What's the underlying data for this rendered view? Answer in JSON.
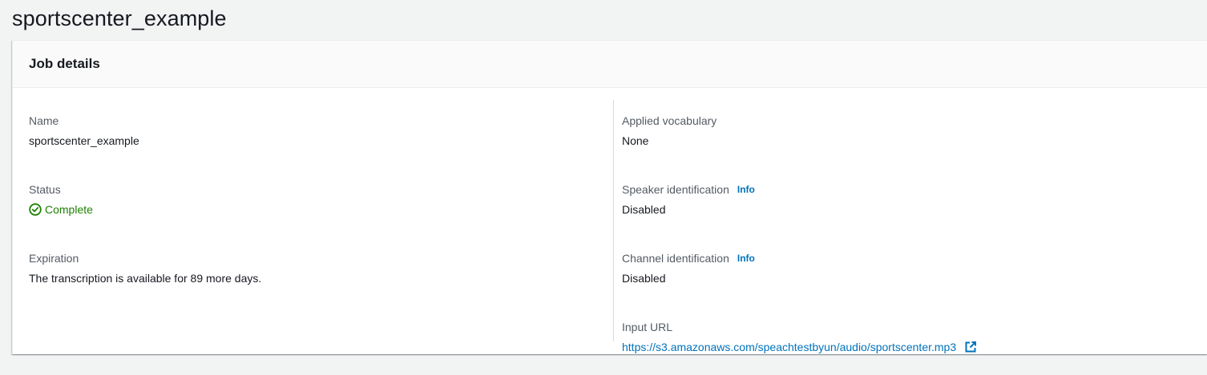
{
  "page": {
    "title": "sportscenter_example"
  },
  "panel": {
    "header": "Job details",
    "left": {
      "name_label": "Name",
      "name_value": "sportscenter_example",
      "status_label": "Status",
      "status_value": "Complete",
      "status_icon": "check-circle-icon",
      "expiration_label": "Expiration",
      "expiration_value": "The transcription is available for 89 more days."
    },
    "right": {
      "vocab_label": "Applied vocabulary",
      "vocab_value": "None",
      "speaker_label": "Speaker identification",
      "speaker_info": "Info",
      "speaker_value": "Disabled",
      "channel_label": "Channel identification",
      "channel_info": "Info",
      "channel_value": "Disabled",
      "input_url_label": "Input URL",
      "input_url_value": "https://s3.amazonaws.com/speachtestbyun/audio/sportscenter.mp3",
      "input_url_icon": "external-link-icon"
    }
  },
  "colors": {
    "success": "#1d8102",
    "link": "#0073bb",
    "label": "#545b64",
    "text": "#16191f"
  }
}
